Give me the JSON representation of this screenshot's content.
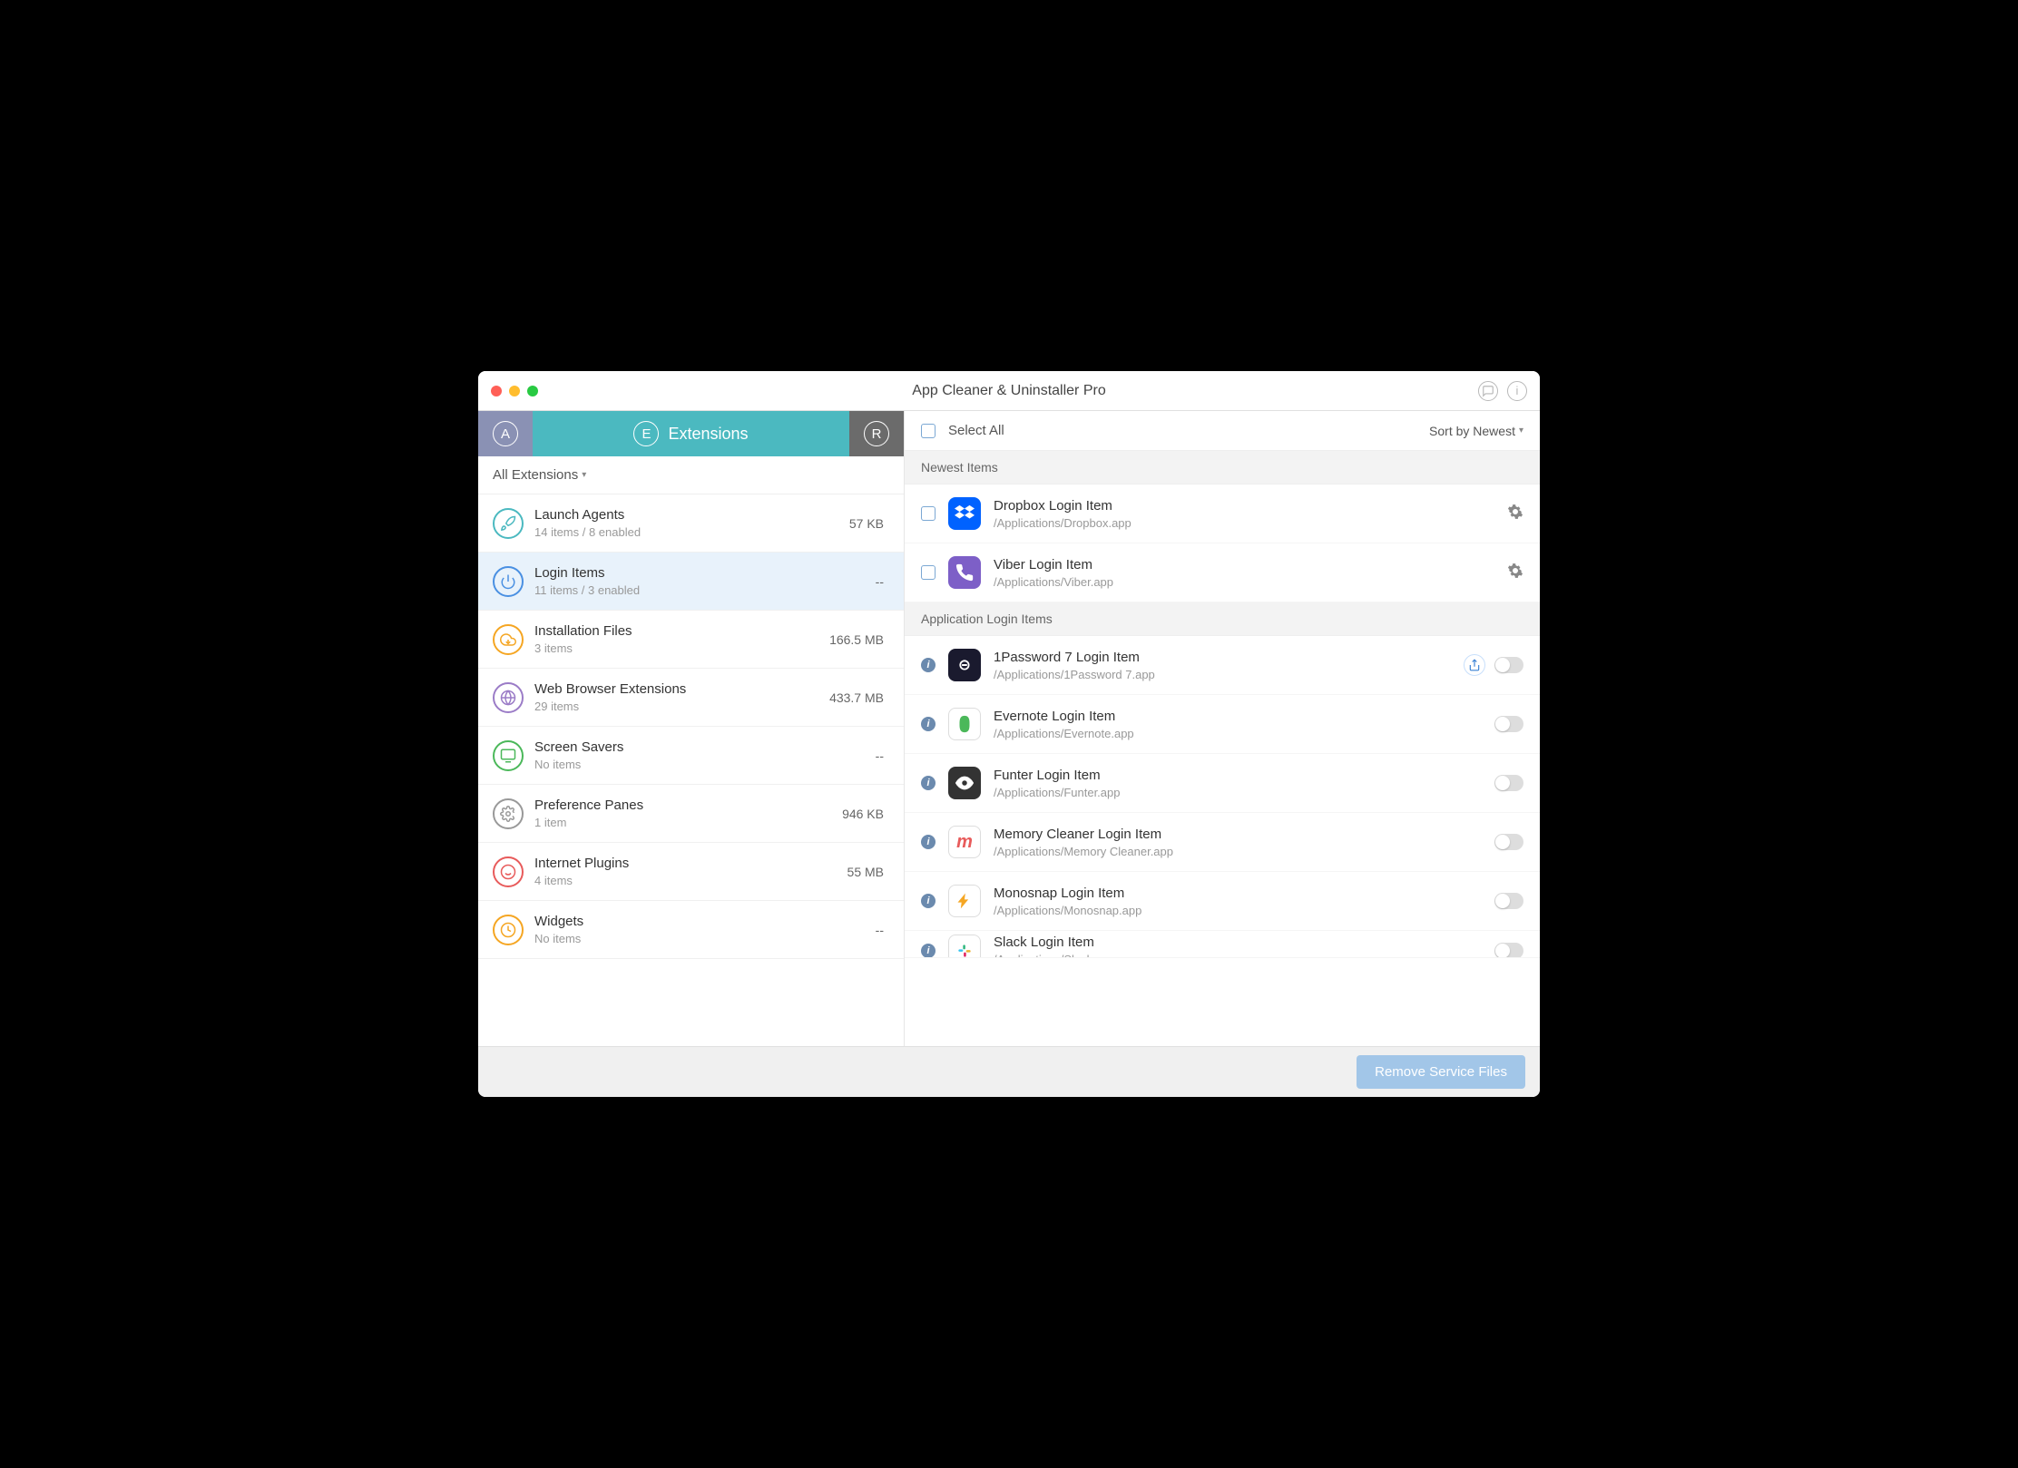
{
  "title": "App Cleaner & Uninstaller Pro",
  "tabs": {
    "extensions": "Extensions"
  },
  "filter": "All Extensions",
  "categories": [
    {
      "name": "Launch Agents",
      "sub": "14 items / 8 enabled",
      "size": "57 KB",
      "color": "teal",
      "glyph": "rocket"
    },
    {
      "name": "Login Items",
      "sub": "11 items / 3 enabled",
      "size": "--",
      "color": "blue",
      "glyph": "power",
      "selected": true
    },
    {
      "name": "Installation Files",
      "sub": "3 items",
      "size": "166.5 MB",
      "color": "orange",
      "glyph": "cloud"
    },
    {
      "name": "Web Browser Extensions",
      "sub": "29 items",
      "size": "433.7 MB",
      "color": "purple",
      "glyph": "globe"
    },
    {
      "name": "Screen Savers",
      "sub": "No items",
      "size": "--",
      "color": "green",
      "glyph": "screen"
    },
    {
      "name": "Preference Panes",
      "sub": "1 item",
      "size": "946 KB",
      "color": "gray",
      "glyph": "gear"
    },
    {
      "name": "Internet Plugins",
      "sub": "4 items",
      "size": "55 MB",
      "color": "red",
      "glyph": "plugin"
    },
    {
      "name": "Widgets",
      "sub": "No items",
      "size": "--",
      "color": "orange",
      "glyph": "widget"
    }
  ],
  "selectAll": "Select All",
  "sort": "Sort by Newest",
  "sections": {
    "newest": "Newest Items",
    "appLogin": "Application Login Items"
  },
  "newestItems": [
    {
      "name": "Dropbox Login Item",
      "path": "/Applications/Dropbox.app",
      "icon": "dropbox"
    },
    {
      "name": "Viber Login Item",
      "path": "/Applications/Viber.app",
      "icon": "viber"
    }
  ],
  "appLoginItems": [
    {
      "name": "1Password 7 Login Item",
      "path": "/Applications/1Password 7.app",
      "icon": "1password",
      "share": true
    },
    {
      "name": "Evernote Login Item",
      "path": "/Applications/Evernote.app",
      "icon": "evernote"
    },
    {
      "name": "Funter Login Item",
      "path": "/Applications/Funter.app",
      "icon": "funter"
    },
    {
      "name": "Memory Cleaner Login Item",
      "path": "/Applications/Memory Cleaner.app",
      "icon": "memory"
    },
    {
      "name": "Monosnap Login Item",
      "path": "/Applications/Monosnap.app",
      "icon": "monosnap"
    },
    {
      "name": "Slack Login Item",
      "path": "/Applications/Slack.app",
      "icon": "slack",
      "partial": true
    }
  ],
  "removeButton": "Remove Service Files"
}
